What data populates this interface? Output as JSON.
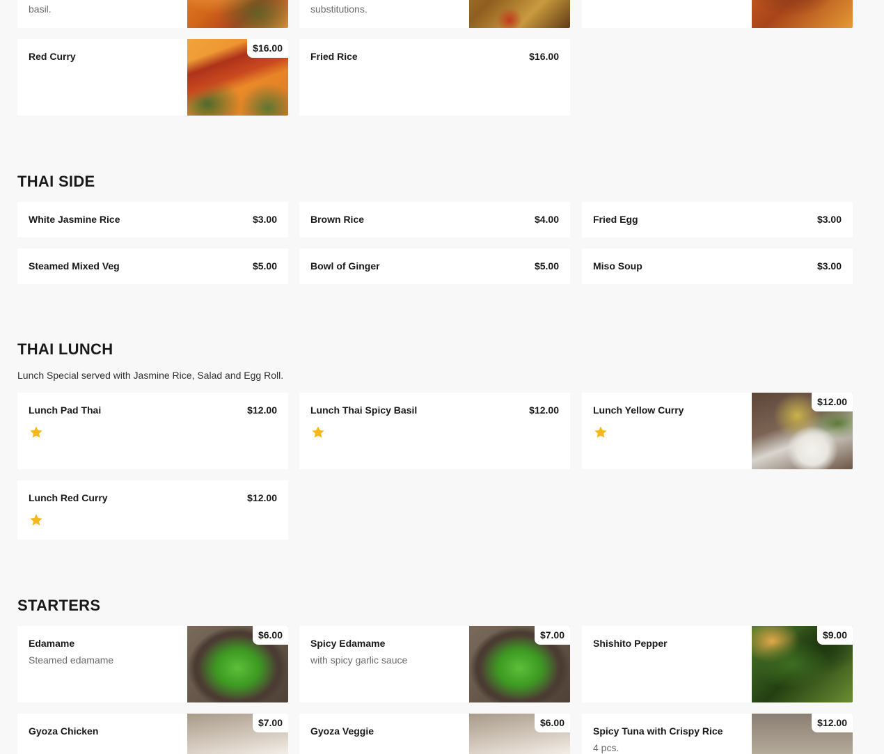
{
  "top_partial": {
    "card1_desc": "basil.",
    "card2_desc": "substitutions."
  },
  "top_items": [
    {
      "name": "Red Curry",
      "price": "$16.00"
    },
    {
      "name": "Fried Rice",
      "price": "$16.00"
    }
  ],
  "thai_side": {
    "title": "THAI SIDE",
    "items": [
      {
        "name": "White Jasmine Rice",
        "price": "$3.00"
      },
      {
        "name": "Brown Rice",
        "price": "$4.00"
      },
      {
        "name": "Fried Egg",
        "price": "$3.00"
      },
      {
        "name": "Steamed Mixed Veg",
        "price": "$5.00"
      },
      {
        "name": "Bowl of Ginger",
        "price": "$5.00"
      },
      {
        "name": "Miso Soup",
        "price": "$3.00"
      }
    ]
  },
  "thai_lunch": {
    "title": "THAI LUNCH",
    "note": "Lunch Special served with Jasmine Rice, Salad and Egg Roll.",
    "items": [
      {
        "name": "Lunch Pad Thai",
        "price": "$12.00",
        "badge": "star-icon"
      },
      {
        "name": "Lunch Thai Spicy Basil",
        "price": "$12.00",
        "badge": "star-icon"
      },
      {
        "name": "Lunch Yellow Curry",
        "price": "$12.00",
        "badge": "star-icon"
      },
      {
        "name": "Lunch Red Curry",
        "price": "$12.00",
        "badge": "star-icon"
      }
    ]
  },
  "starters": {
    "title": "STARTERS",
    "items": [
      {
        "name": "Edamame",
        "desc": "Steamed edamame",
        "price": "$6.00"
      },
      {
        "name": "Spicy Edamame",
        "desc": "with spicy garlic sauce",
        "price": "$7.00"
      },
      {
        "name": "Shishito Pepper",
        "desc": "",
        "price": "$9.00"
      },
      {
        "name": "Gyoza Chicken",
        "desc": "",
        "price": "$7.00"
      },
      {
        "name": "Gyoza Veggie",
        "desc": "",
        "price": "$6.00"
      },
      {
        "name": "Spicy Tuna with Crispy Rice",
        "desc": "4 pcs.",
        "price": "$12.00"
      }
    ]
  },
  "colors": {
    "background": "#f8f8f8",
    "card": "#ffffff",
    "star": "#f5b81c",
    "text": "#191919",
    "muted": "#6b6b6b"
  }
}
